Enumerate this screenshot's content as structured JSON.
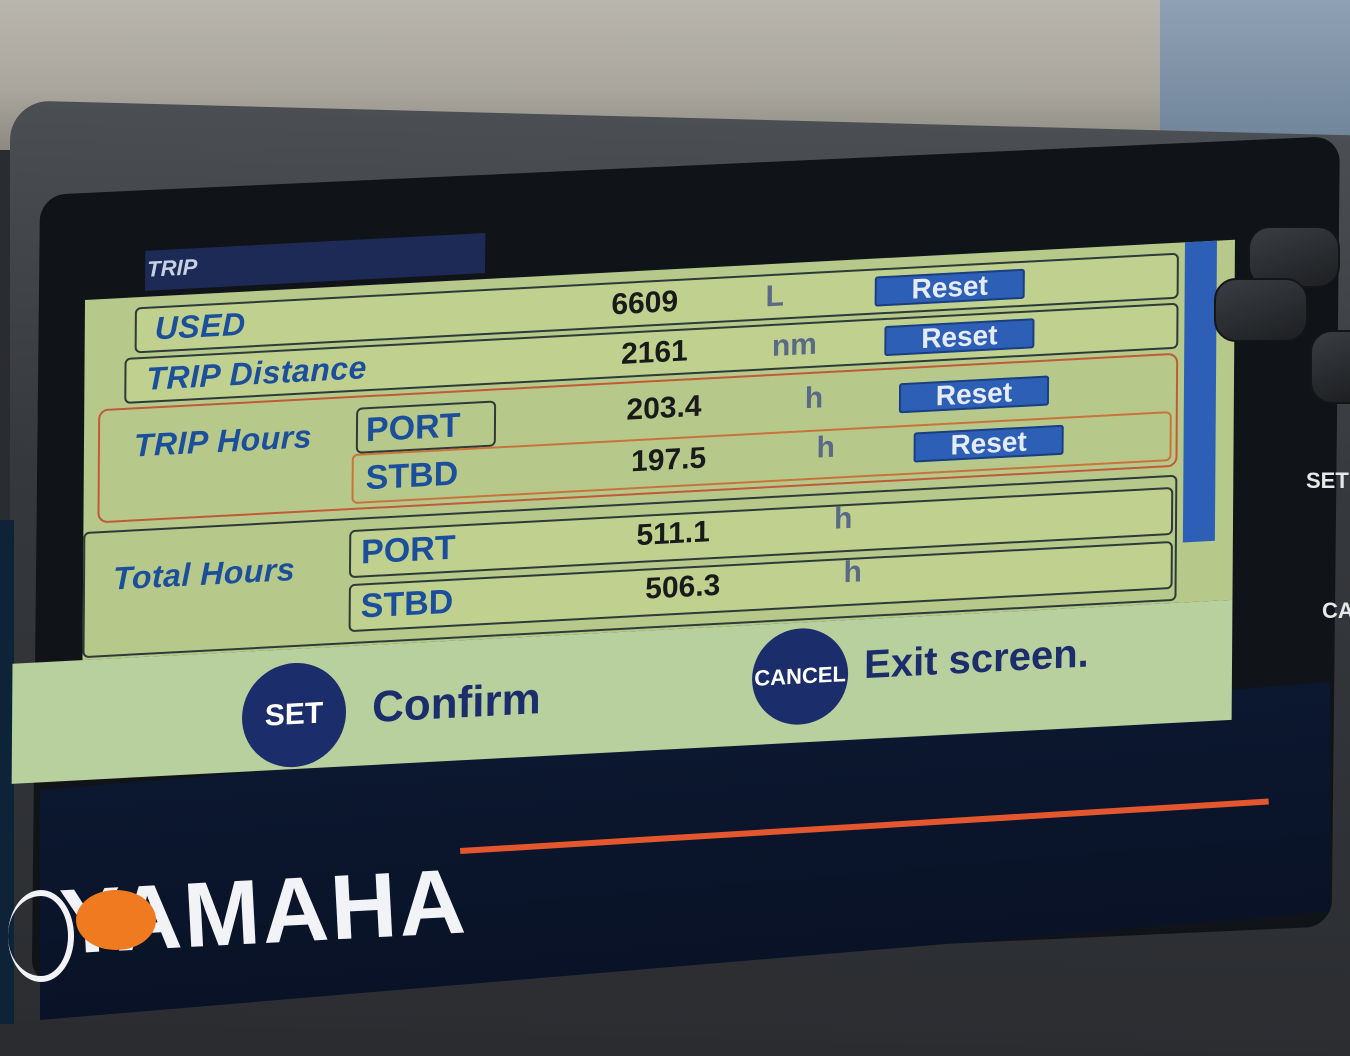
{
  "screen": {
    "section_title": "TRIP",
    "rows": {
      "used": {
        "label": "USED",
        "value": "6609",
        "unit": "L",
        "reset": "Reset"
      },
      "trip_distance": {
        "label": "TRIP Distance",
        "value": "2161",
        "unit": "nm",
        "reset": "Reset"
      },
      "trip_hours": {
        "label": "TRIP Hours",
        "port": {
          "label": "PORT",
          "value": "203.4",
          "unit": "h",
          "reset": "Reset"
        },
        "stbd": {
          "label": "STBD",
          "value": "197.5",
          "unit": "h",
          "reset": "Reset"
        }
      },
      "total_hours": {
        "label": "Total Hours",
        "port": {
          "label": "PORT",
          "value": "511.1",
          "unit": "h"
        },
        "stbd": {
          "label": "STBD",
          "value": "506.3",
          "unit": "h"
        }
      }
    },
    "footer": {
      "set_button": "SET",
      "set_caption": "Confirm",
      "cancel_button": "CANCEL",
      "cancel_caption": "Exit screen."
    }
  },
  "hardware": {
    "side_labels": [
      "SET",
      "CA"
    ]
  },
  "brand": {
    "name": "YAMAHA",
    "accent_color": "#e4572e",
    "panel_color": "#b7c98a",
    "label_color": "#1c4f9b"
  }
}
